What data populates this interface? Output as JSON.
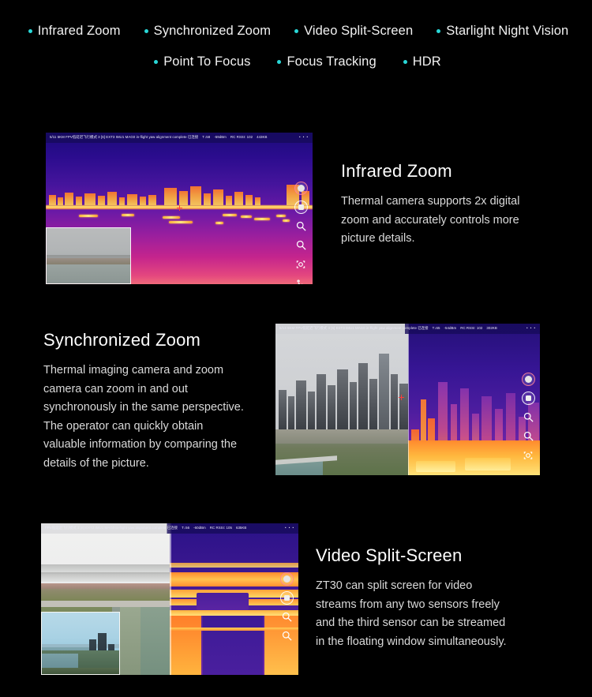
{
  "theme": {
    "background": "#000000",
    "accent_dot": "#29d8d8",
    "title_color": "#ffffff",
    "body_color": "#d9d9d9"
  },
  "feature_tags": {
    "row_1": [
      {
        "label": "Infrared Zoom"
      },
      {
        "label": "Synchronized Zoom"
      },
      {
        "label": "Video Split-Screen"
      },
      {
        "label": "Starlight Night Vision"
      }
    ],
    "row_2": [
      {
        "label": "Point To Focus"
      },
      {
        "label": "Focus Tracking"
      },
      {
        "label": "HDR"
      }
    ]
  },
  "sections": [
    {
      "id": "infrared",
      "title": "Infrared Zoom",
      "body": "Thermal camera supports 2x digital zoom and accurately controls more picture details.",
      "screen": {
        "statusbar": {
          "left": "5/11  5KM FPV低延迟飞行模式 3   [6] EXT3 IMU1 MAG0 in-flight yaw alignment complete 已连接",
          "temp": "T↓58",
          "signal": "-59dBm",
          "rc": "RC RSSI: 102",
          "bitrate": "443KB",
          "dots": "• • •"
        },
        "controls": [
          {
            "icon": "record-icon"
          },
          {
            "icon": "snapshot-icon"
          },
          {
            "icon": "zoom-in-icon"
          },
          {
            "icon": "zoom-out-icon"
          },
          {
            "icon": "target-tracking-icon"
          },
          {
            "icon": "gallery-icon"
          }
        ],
        "pip_label": "visible-light-floating-window"
      }
    },
    {
      "id": "sync",
      "title": "Synchronized Zoom",
      "body": "Thermal imaging camera and zoom camera can zoom in and out synchronously in the same perspective. The operator can quickly obtain valuable information by comparing the details of the picture.",
      "screen": {
        "statusbar": {
          "left": "5/13  5KM FPV低延迟飞行模式 3   [6] EXT3 IMU1 MAG0 in-flight yaw alignment complete 已连接",
          "temp": "T↓65",
          "signal": "-54dBm",
          "rc": "RC RSSI: 102",
          "bitrate": "302KB",
          "dots": "• • •"
        },
        "controls": [
          {
            "icon": "record-icon"
          },
          {
            "icon": "snapshot-icon"
          },
          {
            "icon": "zoom-in-icon"
          },
          {
            "icon": "zoom-out-icon"
          },
          {
            "icon": "target-tracking-icon"
          }
        ]
      }
    },
    {
      "id": "split",
      "title": "Video Split-Screen",
      "body": "ZT30 can split screen for video streams from any two sensors freely and the third sensor can be streamed in the floating window simultaneously.",
      "screen": {
        "statusbar": {
          "left": "FPV低延迟飞行模式 3  [6] EXT3 IMU1 MAG0 in-flight yaw alignment complete 已连接",
          "temp": "T↓56",
          "signal": "-60dBm",
          "rc": "RC RSSI: 105",
          "bitrate": "635KB",
          "dots": "• • •"
        },
        "controls": [
          {
            "icon": "record-icon"
          },
          {
            "icon": "snapshot-icon"
          },
          {
            "icon": "zoom-in-icon"
          },
          {
            "icon": "zoom-out-icon"
          }
        ],
        "pip_label": "third-sensor-floating-window"
      }
    }
  ]
}
